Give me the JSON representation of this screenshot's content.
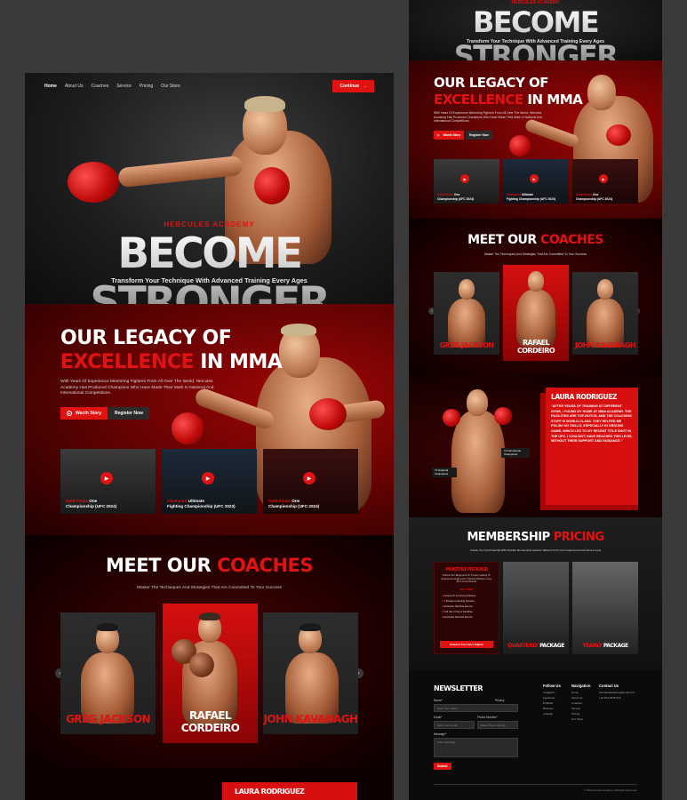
{
  "nav": {
    "items": [
      "Home",
      "About Us",
      "Coaches",
      "Service",
      "Pricing",
      "Our Store"
    ],
    "cta": "Continue"
  },
  "hero": {
    "eyebrow": "HERCULES ACADEMY",
    "title": "BECOME STRONGER",
    "subtitle": "Transform Your Technique With Advanced Training Every Ages"
  },
  "legacy": {
    "title_line1": "OUR LEGACY OF",
    "title_red": "EXCELLENCE",
    "title_rest": " IN MMA",
    "body": "With Years Of Experience Mentoring Fighters From All Over The World, Hercules Academy Has Produced Champions Who Have Made Their Mark In National And International Competitions.",
    "watch_label": "Wacth Story",
    "register_label": "Register Now",
    "videos": [
      {
        "red": "Gold Finals",
        "line1": "One",
        "line2": "Championship (UFC 2024)"
      },
      {
        "red": "Champion",
        "line1": "Ultimate",
        "line2": "Fighting Championship (UFC 2023)"
      },
      {
        "red": "Gold Finals",
        "line1": "One",
        "line2": "Championship (UFC 2024)"
      }
    ]
  },
  "coaches": {
    "title_white": "MEET OUR ",
    "title_red": "COACHES",
    "subtitle": "Master The Techniques And Strategies That Are Committed To Your Success",
    "cards": [
      {
        "name": "GREG JACKSON"
      },
      {
        "name": "RAFAEL CORDEIRO"
      },
      {
        "name": "JOHN KAVANAGH"
      }
    ]
  },
  "bottom_teaser": "LAURA RODRIGUEZ",
  "testimonial": {
    "name": "LAURA RODRIGUEZ",
    "quote": "\"AFTER YEARS OF TRAINING AT DIFFERENT GYMS, I FOUND MY HOME AT MMA ACADEMY. THE FACILITIES ARE TOP-NOTCH, AND THE COACHING STAFF IS WORLD-CLASS. THEY HELPED ME POLISH MY SKILLS, ESPECIALLY IN GROUND GAME, WHICH LED TO MY RECENT TITLE SHOT IN THE UFC. I COULDN'T HAVE REACHED THIS LEVEL WITHOUT THEIR SUPPORT AND GUIDANCE.\"",
    "badge1": "3 International Champions",
    "badge2": "72 National Champions"
  },
  "membership": {
    "title_white": "MEMBERSHIP ",
    "title_red": "PRICING",
    "subtitle": "Unlock Your Full Potential With Flexible Membership Options Tailored To Fit Your Goals And Commitment Level",
    "plan_title": "MONTHLY PACKAGE",
    "plan_desc": "Perfect For Beginners Or Those Looking To Experience High-Level Training Without Long-Term Commitment.",
    "includes_label": "INCLUDES",
    "features": [
      "Access To 12 Group Classes",
      "1 Private Coaching Session",
      "Exclusive Member Events",
      "Full Use Of Gym Facilities",
      "Exclusive Member Events"
    ],
    "plan_cta": "Unleash Your Inner Fighter",
    "card2": {
      "red": "QUARTERLY",
      "white": " PACKAGE"
    },
    "card3": {
      "red": "YEARLY",
      "white": " PACKAGE"
    }
  },
  "newsletter": {
    "title": "NEWSLETTER",
    "name_label": "Name*",
    "name_ph": "Enter Your Name",
    "email_label": "Email*",
    "email_ph": "Enter Your Email",
    "phone_label": "Phone Number*",
    "phone_ph": "Enter Phone Number",
    "msg_label": "Message*",
    "msg_ph": "Enter Message",
    "submit": "Submit",
    "privacy": "Privacy"
  },
  "footer": {
    "follow": {
      "title": "Follow Us",
      "items": [
        "Instagram",
        "Facebook",
        "Dribbble",
        "Behance",
        "Linkedin"
      ]
    },
    "navigation": {
      "title": "Navigation",
      "items": [
        "Home",
        "About Us",
        "Coaches",
        "Service",
        "Pricing",
        "Our Store"
      ]
    },
    "contact": {
      "title": "Contact Us",
      "items": [
        "herculesacademy@gmail.com",
        "+62 813-4578 976"
      ]
    },
    "copyright": "© 2024 Hercules Academy. All Rights Reserved."
  },
  "colors": {
    "accent": "#e01313",
    "bg": "#0a0a0a",
    "frame": "#3a3a3a"
  }
}
